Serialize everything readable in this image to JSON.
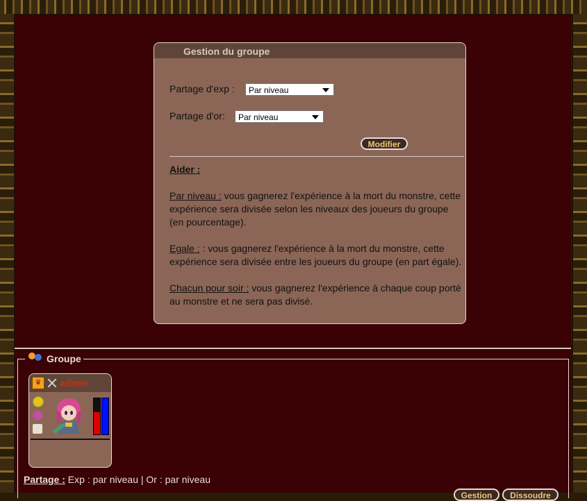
{
  "panel": {
    "title": "Gestion du groupe",
    "exp_label": "Partage d'exp :",
    "exp_value": "Par niveau",
    "gold_label": "Partage d'or:",
    "gold_value": "Par niveau",
    "modify_button": "Modifier",
    "help_title": "Aider :",
    "help": [
      {
        "term": "Par niveau :",
        "text": " vous gagnerez l'expérience à la mort du monstre, cette expérience sera divisée selon les niveaux des joueurs du groupe (en pourcentage)."
      },
      {
        "term": "Egale :",
        "text": " : vous gagnerez l'expérience à la mort du monstre, cette expérience sera divisée entre les joueurs du groupe (en part égale)."
      },
      {
        "term": "Chacun pour soir :",
        "text": " vous gagnerez l'expérience à chaque coup porté au monstre et ne sera pas divisé."
      }
    ]
  },
  "group": {
    "legend": "Groupe",
    "members": [
      {
        "name": "admin",
        "hp_fraction": 0.62,
        "mp_fraction": 1.0
      }
    ],
    "share_label": "Partage :",
    "share_text": " Exp : par niveau | Or : par niveau",
    "buttons": {
      "manage": "Gestion",
      "dissolve": "Dissoudre"
    }
  },
  "colors": {
    "background": "#3a0204",
    "panel": "#8b6656",
    "panel_header": "#5e4538",
    "button_text": "#f0c87a",
    "member_name": "#c83010",
    "hp": "#e00000",
    "mp": "#0010ff"
  }
}
